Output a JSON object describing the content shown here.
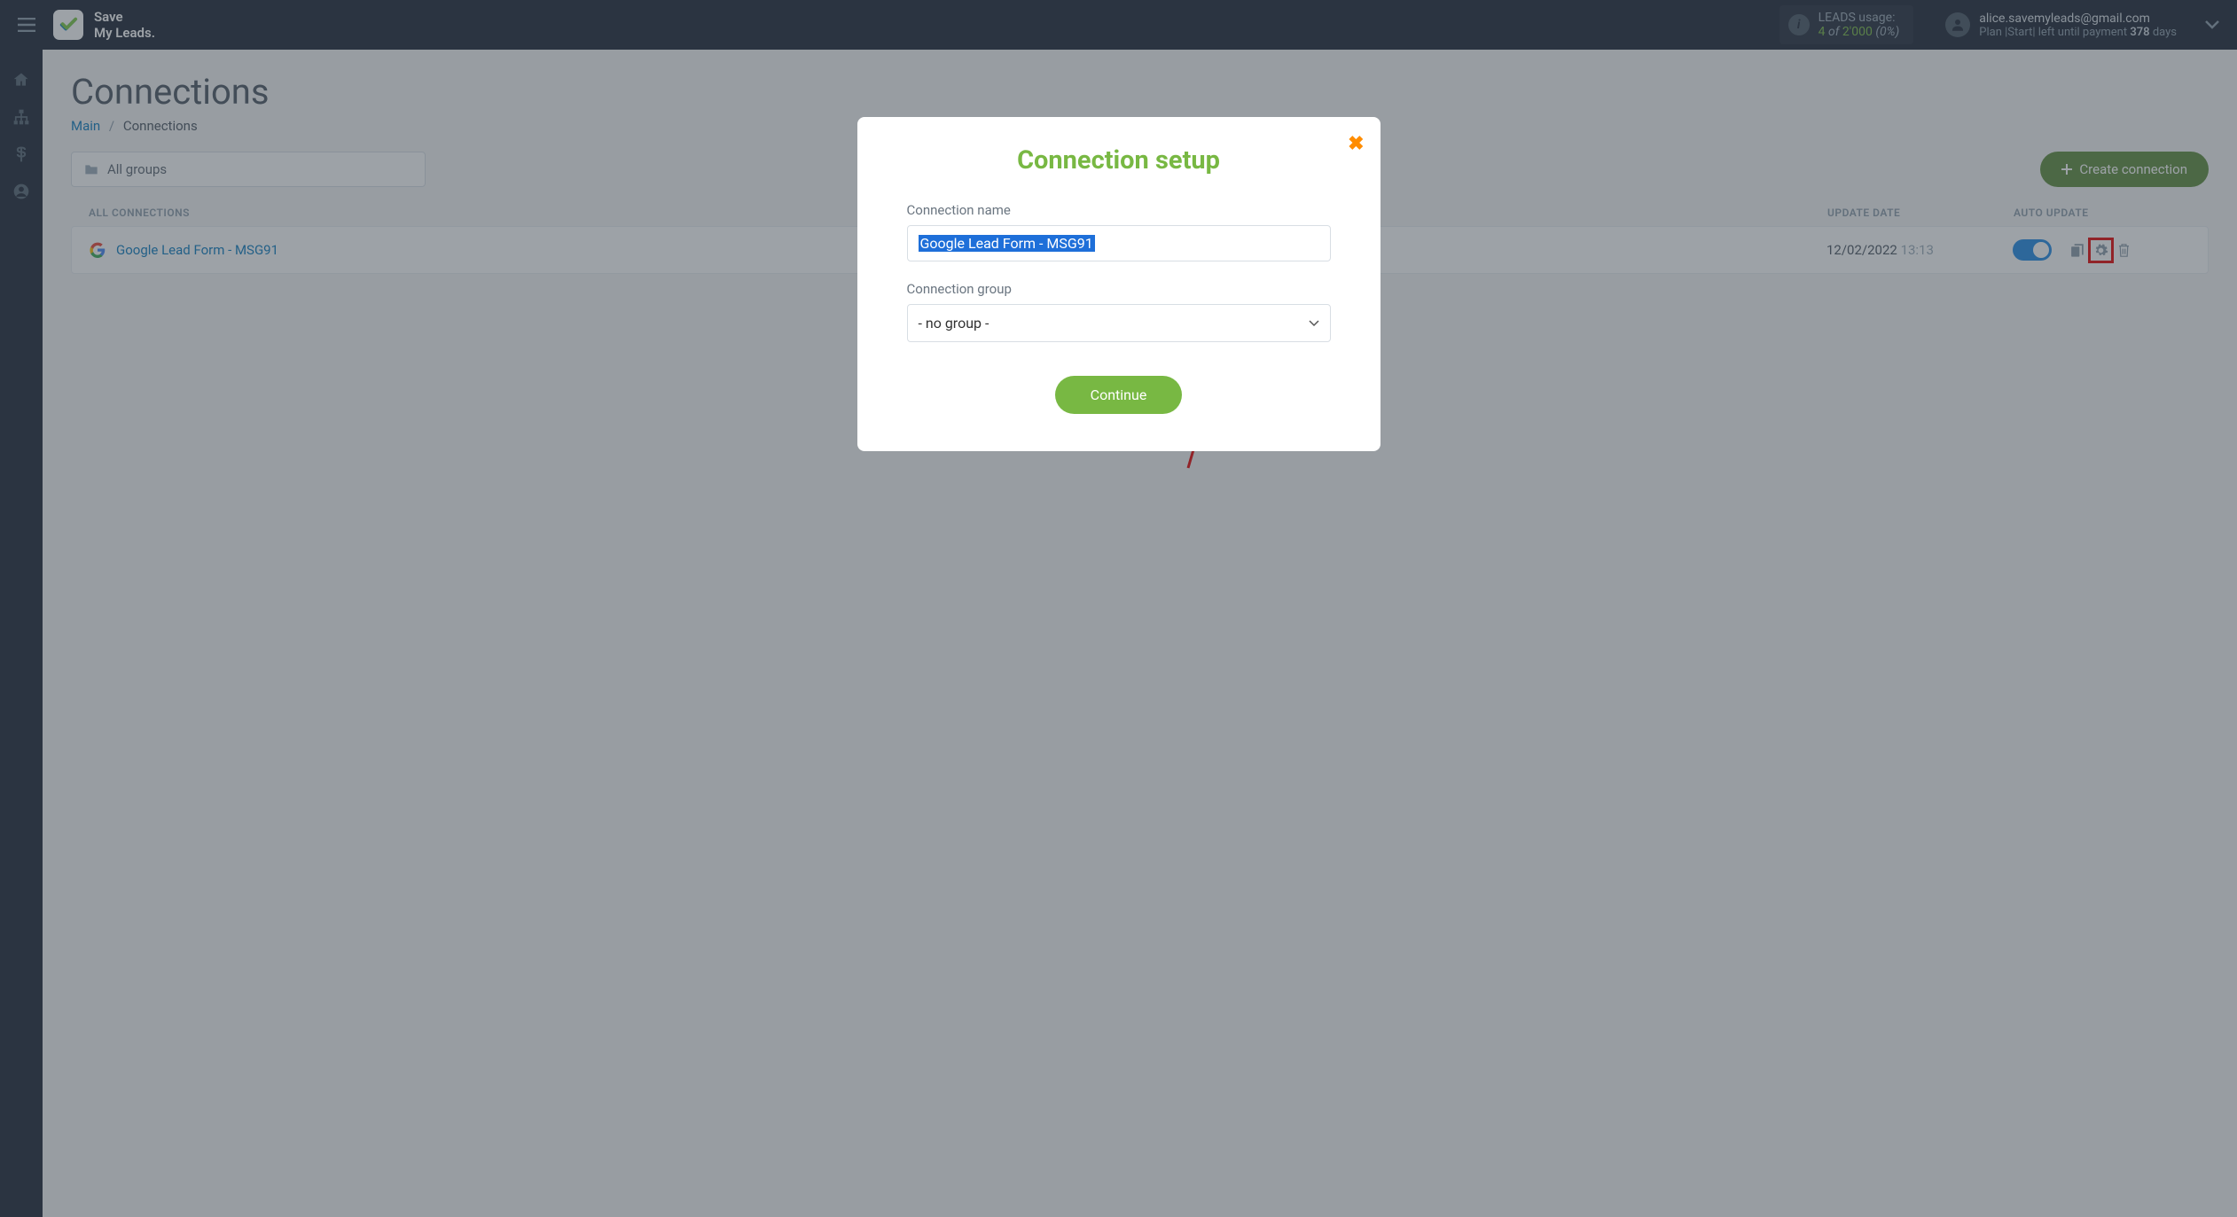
{
  "header": {
    "logo_line1": "Save",
    "logo_line2": "My Leads.",
    "leads_label": "LEADS usage:",
    "leads_count": "4",
    "leads_of": "of",
    "leads_total": "2'000",
    "leads_pct": "(0%)",
    "account_email": "alice.savemyleads@gmail.com",
    "plan_prefix": "Plan |",
    "plan_name": "Start",
    "plan_suffix": "| left until payment",
    "days_count": "378",
    "days_label": "days"
  },
  "page": {
    "title": "Connections",
    "breadcrumb_main": "Main",
    "breadcrumb_current": "Connections",
    "group_filter": "All groups",
    "create_btn": "Create connection"
  },
  "table": {
    "head_name": "ALL CONNECTIONS",
    "head_date": "UPDATE DATE",
    "head_auto": "AUTO UPDATE"
  },
  "row": {
    "name": "Google Lead Form - MSG91",
    "date": "12/02/2022",
    "time": "13:13"
  },
  "modal": {
    "title": "Connection setup",
    "name_label": "Connection name",
    "name_value": "Google Lead Form - MSG91",
    "group_label": "Connection group",
    "group_value": "- no group -",
    "continue": "Continue"
  }
}
